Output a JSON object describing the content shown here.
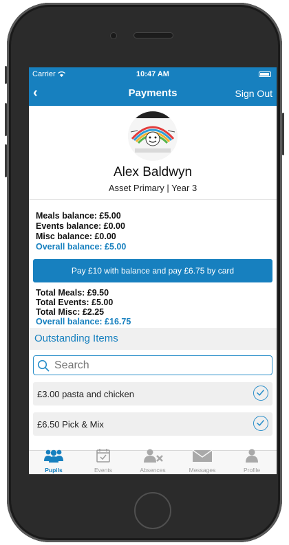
{
  "status_bar": {
    "carrier": "Carrier",
    "time": "10:47 AM"
  },
  "nav": {
    "title": "Payments",
    "sign_out": "Sign Out"
  },
  "pupil": {
    "name": "Alex Baldwyn",
    "school": "Asset Primary | Year 3"
  },
  "balances": {
    "meals": "Meals balance: £5.00",
    "events": "Events balance: £0.00",
    "misc": "Misc balance: £0.00",
    "overall": "Overall balance: £5.00"
  },
  "pay_button": "Pay £10 with balance and pay £6.75 by card",
  "totals": {
    "meals": "Total Meals: £9.50",
    "events": "Total Events: £5.00",
    "misc": "Total Misc: £2.25",
    "overall": "Overall balance: £16.75"
  },
  "outstanding_header": "Outstanding Items",
  "search": {
    "placeholder": "Search"
  },
  "items": [
    {
      "label": "£3.00 pasta and chicken",
      "checked": true
    },
    {
      "label": "£6.50 Pick & Mix",
      "checked": true
    }
  ],
  "tabs": [
    {
      "label": "Pupils",
      "icon": "pupils-icon",
      "active": true
    },
    {
      "label": "Events",
      "icon": "calendar-icon",
      "active": false
    },
    {
      "label": "Absences",
      "icon": "absence-icon",
      "active": false
    },
    {
      "label": "Messages",
      "icon": "envelope-icon",
      "active": false
    },
    {
      "label": "Profile",
      "icon": "profile-icon",
      "active": false
    }
  ],
  "colors": {
    "accent": "#1780bf",
    "tab_inactive": "#9c9c9c",
    "row_bg": "#efefef"
  }
}
